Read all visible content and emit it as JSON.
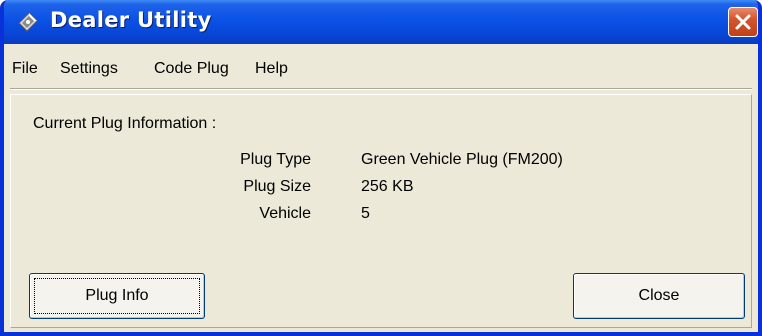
{
  "window": {
    "title": "Dealer Utility",
    "icon": "dealer-utility-icon",
    "close_icon": "close-icon"
  },
  "menu": {
    "items": [
      "File",
      "Settings",
      "Code Plug",
      "Help"
    ]
  },
  "plug_info": {
    "section_title": "Current Plug Information :",
    "fields": [
      {
        "label": "Plug Type",
        "value": "Green Vehicle Plug (FM200)"
      },
      {
        "label": "Plug Size",
        "value": "256 KB"
      },
      {
        "label": "Vehicle",
        "value": "5"
      }
    ]
  },
  "buttons": {
    "plug_info": "Plug Info",
    "close": "Close"
  },
  "colors": {
    "titlebar": "#0a52e6",
    "window_bg": "#ece9d8",
    "close_button": "#d6552c"
  }
}
